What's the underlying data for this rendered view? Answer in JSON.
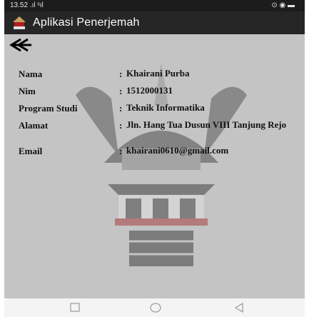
{
  "status_bar": {
    "time": "13.52",
    "signal": ".ıl ˢıl",
    "indicators": "⊙ ◉ ▬"
  },
  "app_bar": {
    "title": "Aplikasi Penerjemah",
    "logo_icon": "batak-house-icon"
  },
  "back_icon": "double-back-arrow-icon",
  "separator": ":",
  "profile": {
    "fields": [
      {
        "label": "Nama",
        "value": "Khairani Purba"
      },
      {
        "label": "Nim",
        "value": "1512000131"
      },
      {
        "label": "Program Studi",
        "value": "Teknik Informatika"
      },
      {
        "label": "Alamat",
        "value": "Jln. Hang Tua Dusun VIII Tanjung Rejo"
      },
      {
        "label": "Email",
        "value": "khairani0610@gmail.com"
      }
    ]
  },
  "nav_bar": {
    "icons": [
      "recents-square-icon",
      "home-circle-icon",
      "back-triangle-icon"
    ]
  },
  "colors": {
    "background": "#c4c4c4",
    "app_bar": "#262626",
    "status_bar": "#1c1c1c",
    "text": "#111111"
  }
}
